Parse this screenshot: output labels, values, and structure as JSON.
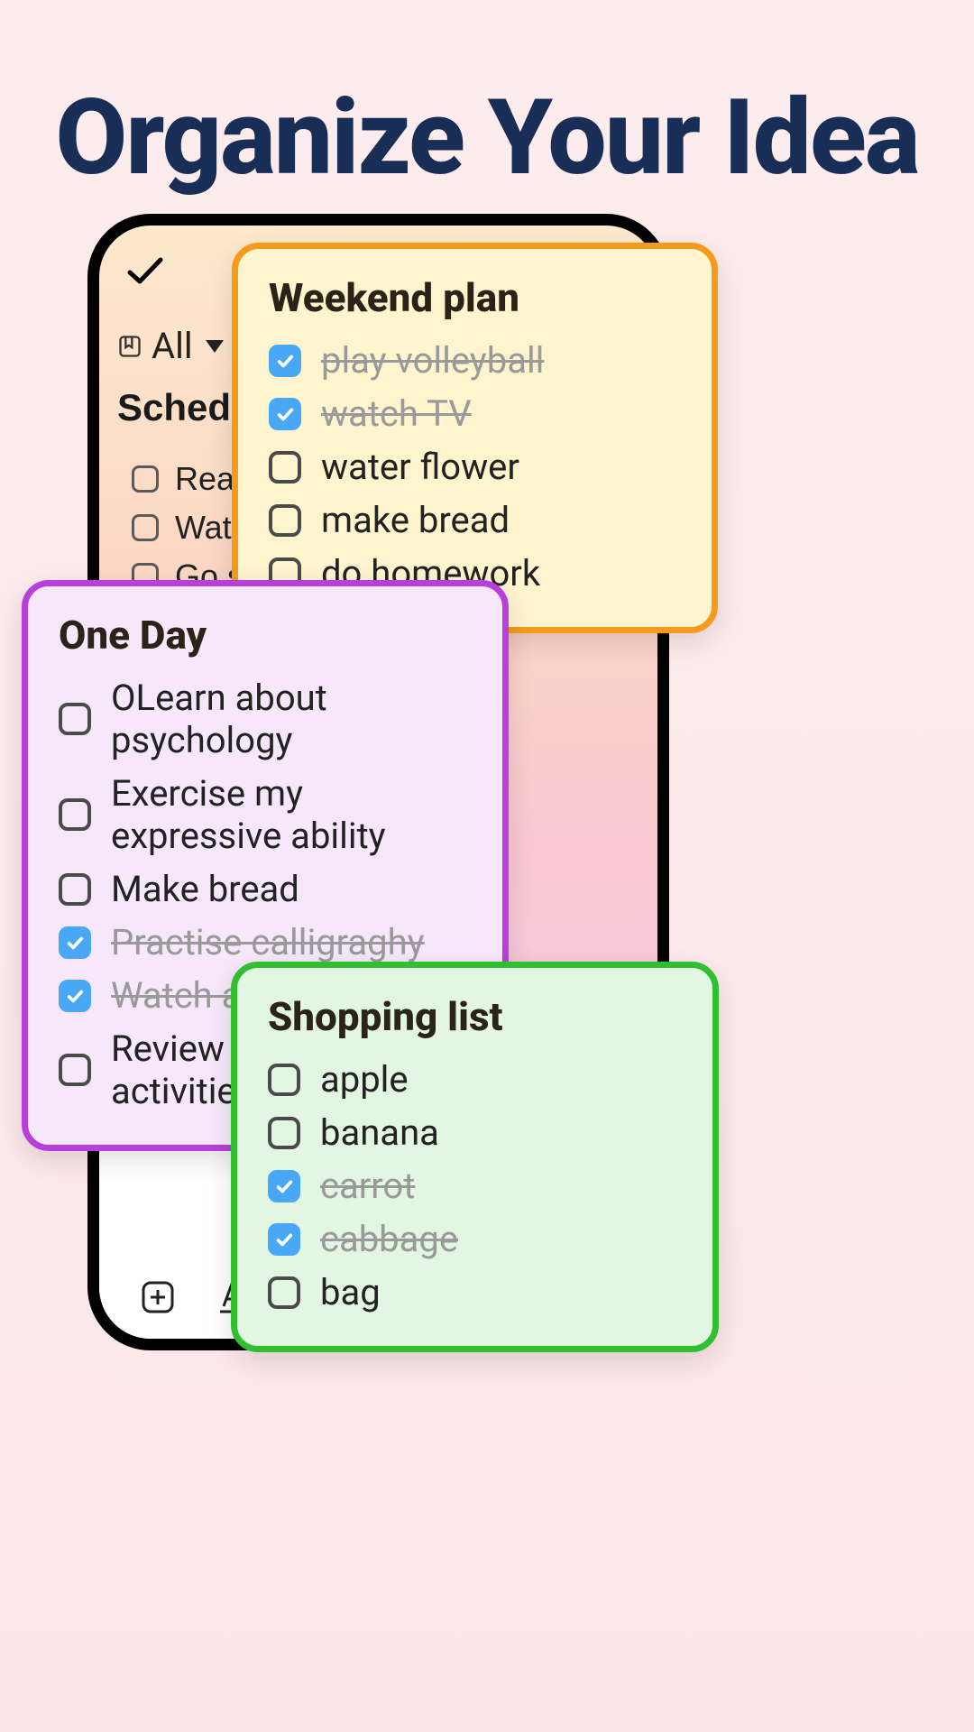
{
  "headline": "Organize Your Idea",
  "phone": {
    "filter_label": "All",
    "schedual_title": "Schedual",
    "bg_items": [
      "Read a",
      "Water t",
      "Go swimming"
    ]
  },
  "cards": {
    "weekend": {
      "title": "Weekend plan",
      "items": [
        {
          "text": "play volleyball",
          "checked": true
        },
        {
          "text": "watch TV",
          "checked": true
        },
        {
          "text": "water flower",
          "checked": false
        },
        {
          "text": "make bread",
          "checked": false
        },
        {
          "text": "do homework",
          "checked": false
        }
      ]
    },
    "oneday": {
      "title": "One Day",
      "items": [
        {
          "text": "OLearn about psychology",
          "checked": false
        },
        {
          "text": "Exercise my expressive ability",
          "checked": false
        },
        {
          "text": "Make bread",
          "checked": false
        },
        {
          "text": "Practise calligraghy",
          "checked": true
        },
        {
          "text": "Watch a movie",
          "checked": true
        },
        {
          "text": "Review todays activities",
          "checked": false
        }
      ]
    },
    "shopping": {
      "title": "Shopping list",
      "items": [
        {
          "text": "apple",
          "checked": false
        },
        {
          "text": "banana",
          "checked": false
        },
        {
          "text": "carrot",
          "checked": true
        },
        {
          "text": "cabbage",
          "checked": true
        },
        {
          "text": "bag",
          "checked": false
        }
      ]
    }
  }
}
